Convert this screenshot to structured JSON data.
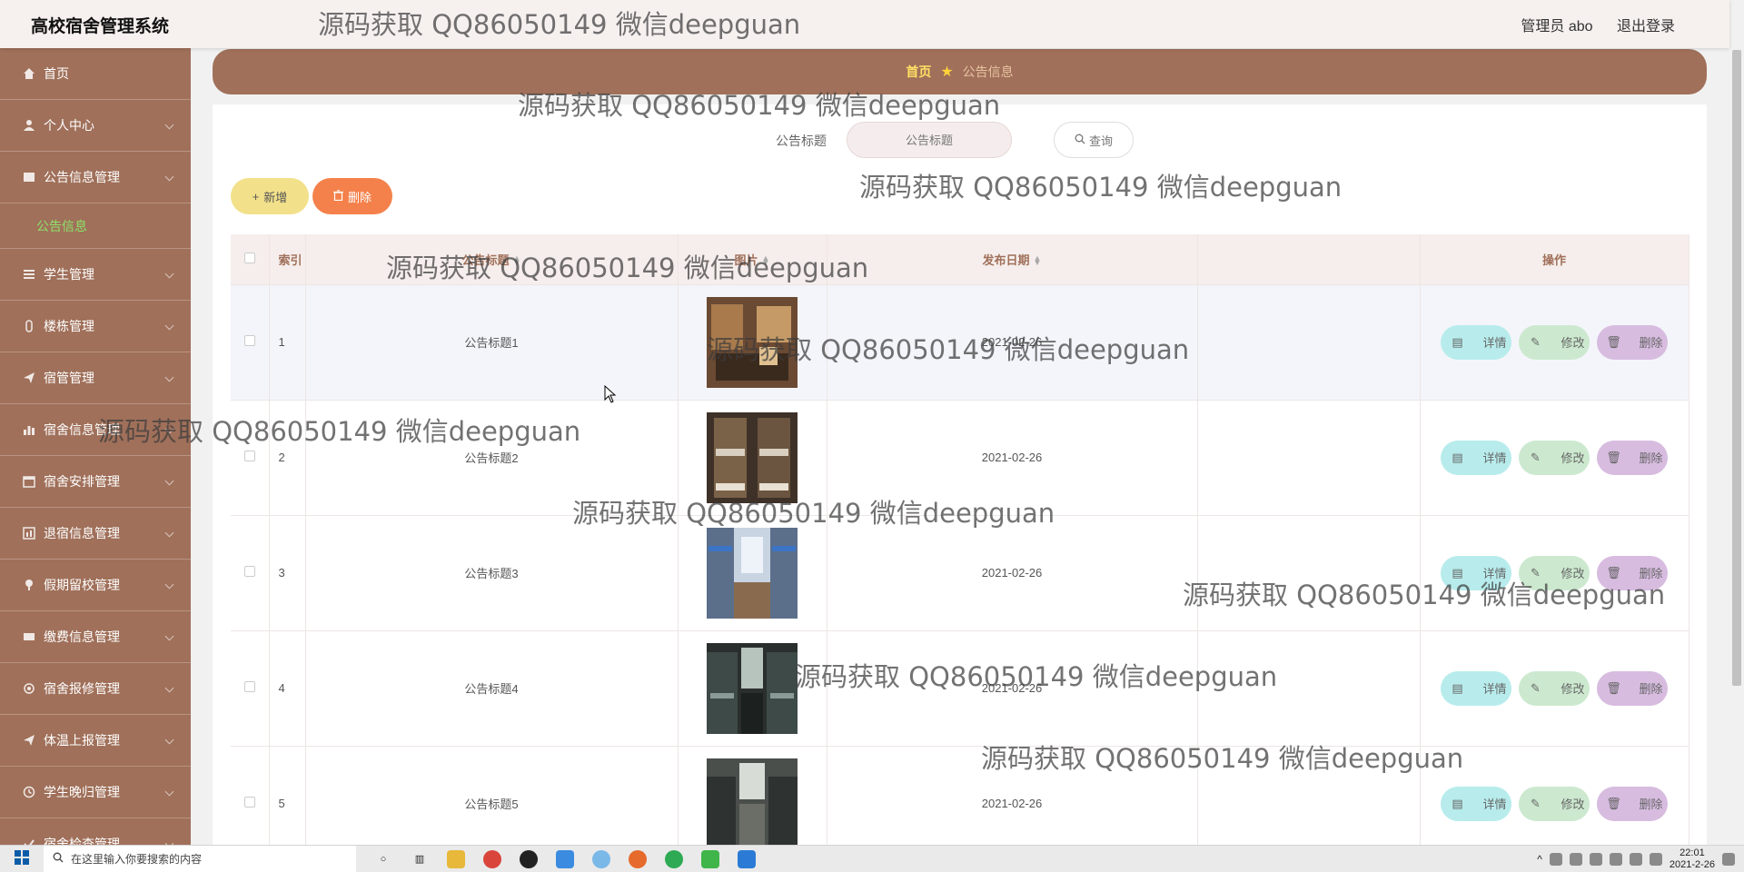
{
  "header": {
    "title": "高校宿舍管理系统",
    "user_label": "管理员 abo",
    "logout": "退出登录"
  },
  "sidebar": {
    "items": [
      {
        "label": "首页",
        "icon": "home-icon"
      },
      {
        "label": "个人中心",
        "icon": "user-icon"
      },
      {
        "label": "公告信息管理",
        "icon": "notice-icon"
      },
      {
        "label": "学生管理",
        "icon": "list-icon"
      },
      {
        "label": "楼栋管理",
        "icon": "building-icon"
      },
      {
        "label": "宿管管理",
        "icon": "send-icon"
      },
      {
        "label": "宿舍信息管理",
        "icon": "chart-icon"
      },
      {
        "label": "宿舍安排管理",
        "icon": "calendar-icon"
      },
      {
        "label": "退宿信息管理",
        "icon": "bar-icon"
      },
      {
        "label": "假期留校管理",
        "icon": "pin-icon"
      },
      {
        "label": "缴费信息管理",
        "icon": "card-icon"
      },
      {
        "label": "宿舍报修管理",
        "icon": "tool-icon"
      },
      {
        "label": "体温上报管理",
        "icon": "send-icon"
      },
      {
        "label": "学生晚归管理",
        "icon": "clock-icon"
      },
      {
        "label": "宿舍检查管理",
        "icon": "check-icon"
      }
    ],
    "sub_active": "公告信息"
  },
  "breadcrumb": {
    "home": "首页",
    "current": "公告信息"
  },
  "search": {
    "label": "公告标题",
    "placeholder": "公告标题",
    "button": "查询"
  },
  "toolbar": {
    "add": "新增",
    "delete": "删除"
  },
  "table": {
    "headers": {
      "index": "索引",
      "title": "公告标题",
      "image": "图片",
      "date": "发布日期",
      "ops": "操作"
    },
    "rows": [
      {
        "index": "1",
        "title": "公告标题1",
        "date": "2021-02-26"
      },
      {
        "index": "2",
        "title": "公告标题2",
        "date": "2021-02-26"
      },
      {
        "index": "3",
        "title": "公告标题3",
        "date": "2021-02-26"
      },
      {
        "index": "4",
        "title": "公告标题4",
        "date": "2021-02-26"
      },
      {
        "index": "5",
        "title": "公告标题5",
        "date": "2021-02-26"
      }
    ],
    "ops": {
      "detail": "详情",
      "edit": "修改",
      "remove": "删除"
    }
  },
  "watermark": "源码获取 QQ86050149 微信deepguan",
  "taskbar": {
    "search_placeholder": "在这里输入你要搜索的内容",
    "time": "22:01",
    "date": "2021-2-26"
  },
  "colors": {
    "sidebar": "#a0705a",
    "accent_active": "#8ee06a",
    "add_button": "#f2e08a",
    "delete_button": "#f4814b",
    "detail": "#b8ecec",
    "edit": "#cce9cf",
    "remove": "#d7bce0"
  }
}
